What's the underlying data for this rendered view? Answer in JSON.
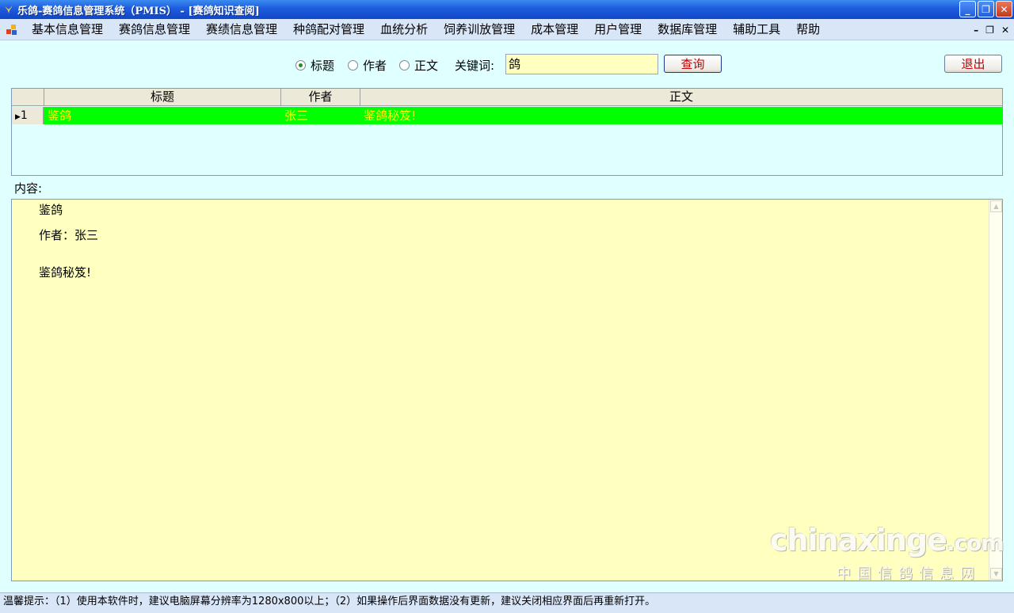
{
  "window": {
    "title": "乐鸽-赛鸽信息管理系统（PMIS） - [赛鸽知识查阅]"
  },
  "menu": {
    "items": [
      "基本信息管理",
      "赛鸽信息管理",
      "赛绩信息管理",
      "种鸽配对管理",
      "血统分析",
      "饲养训放管理",
      "成本管理",
      "用户管理",
      "数据库管理",
      "辅助工具",
      "帮助"
    ]
  },
  "search": {
    "options": [
      {
        "label": "标题",
        "checked": true
      },
      {
        "label": "作者",
        "checked": false
      },
      {
        "label": "正文",
        "checked": false
      }
    ],
    "keyword_label": "关键词:",
    "keyword_value": "鸽",
    "query_button": "查询",
    "exit_button": "退出"
  },
  "grid": {
    "columns": [
      "标题",
      "作者",
      "正文"
    ],
    "rows": [
      {
        "index": "1",
        "title": "鉴鸽",
        "author": "张三",
        "body": "鉴鸽秘笈!"
      }
    ]
  },
  "content": {
    "label": "内容:",
    "title": "鉴鸽",
    "author_line": "作者：张三",
    "body": "鉴鸽秘笈!"
  },
  "watermark": {
    "main": "chinaxinge",
    "suffix": ".com",
    "sub": "中国信鸽信息网"
  },
  "status": {
    "text": "温馨提示：（1）使用本软件时，建议电脑屏幕分辨率为1280x800以上；（2）如果操作后界面数据没有更新，建议关闭相应界面后再重新打开。"
  }
}
